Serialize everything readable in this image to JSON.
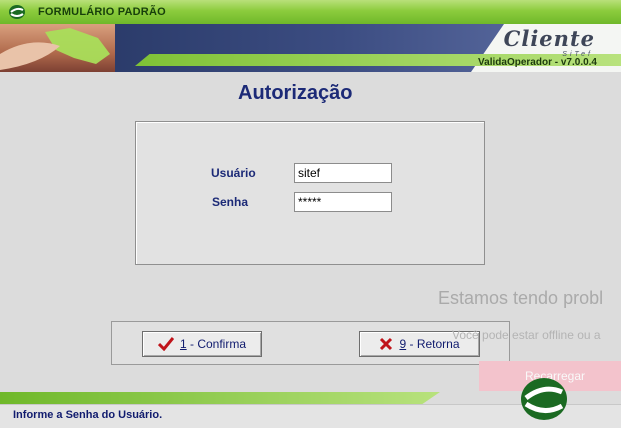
{
  "window": {
    "title": "FORMULÁRIO PADRÃO"
  },
  "banner": {
    "brand": "Cliente",
    "brand_sub": "SiTef",
    "version": "ValidaOperador - v7.0.0.4"
  },
  "form": {
    "heading": "Autorização",
    "user_label": "Usuário",
    "user_value": "sitef",
    "password_label": "Senha",
    "password_value": "*****"
  },
  "buttons": {
    "confirm": {
      "key": "1",
      "label": " - Confirma"
    },
    "back": {
      "key": "9",
      "label": " - Retorna"
    }
  },
  "overlay": {
    "title": "Estamos tendo probl",
    "subtitle": "Você pode estar offline ou a",
    "reload_label": "Recarregar"
  },
  "status": {
    "text": "Informe a Senha do Usuário."
  },
  "colors": {
    "accent_green": "#8ccc3d",
    "text_blue": "#1c2a77",
    "banner_blue": "#23335f"
  }
}
